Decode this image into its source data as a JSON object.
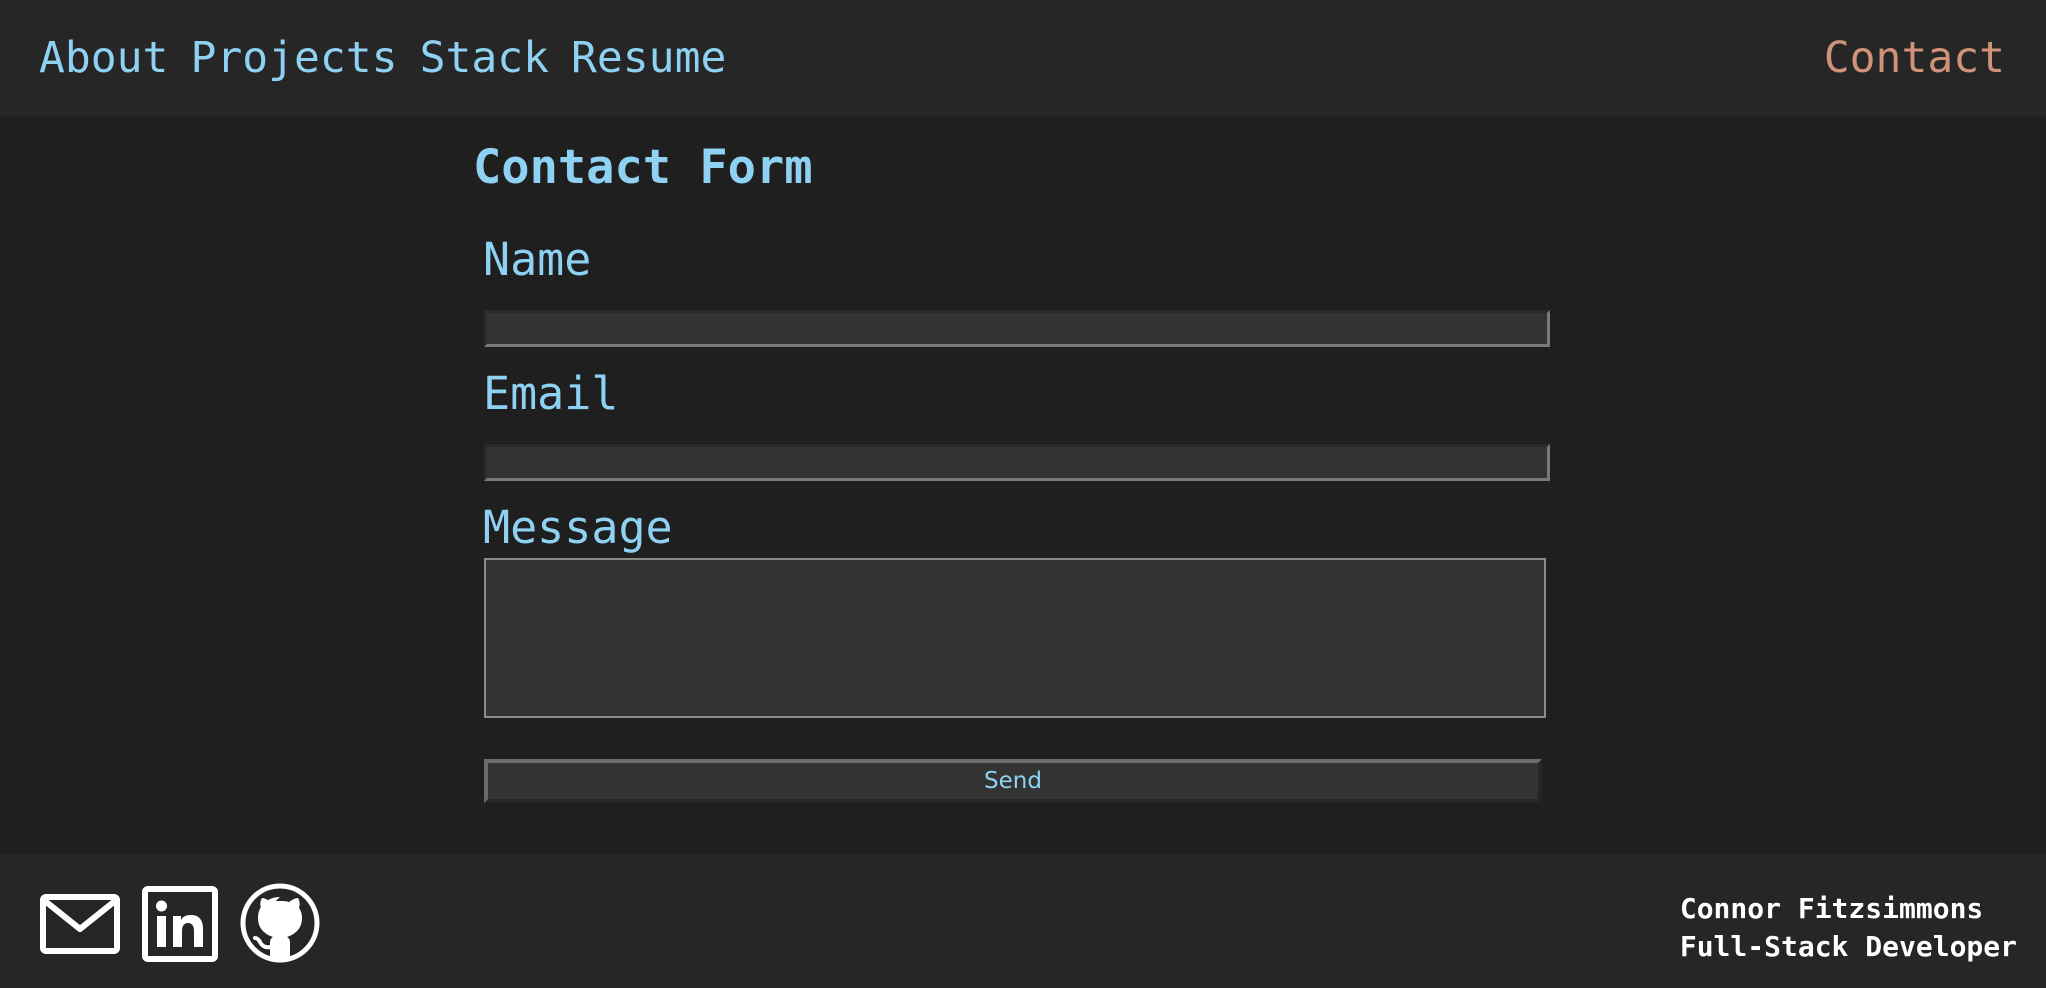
{
  "nav": {
    "links": [
      "About",
      "Projects",
      "Stack",
      "Resume"
    ],
    "contact": "Contact"
  },
  "form": {
    "title": "Contact Form",
    "name_label": "Name",
    "email_label": "Email",
    "message_label": "Message",
    "name_value": "",
    "email_value": "",
    "message_value": "",
    "send_label": "Send"
  },
  "footer": {
    "icons": [
      "mail-icon",
      "linkedin-icon",
      "github-icon"
    ],
    "name": "Connor Fitzsimmons",
    "role": "Full-Stack Developer"
  },
  "colors": {
    "accent_blue": "#8fd1f2",
    "accent_orange": "#d0937a",
    "background": "#1f1f1f",
    "bar_background": "#262626"
  }
}
